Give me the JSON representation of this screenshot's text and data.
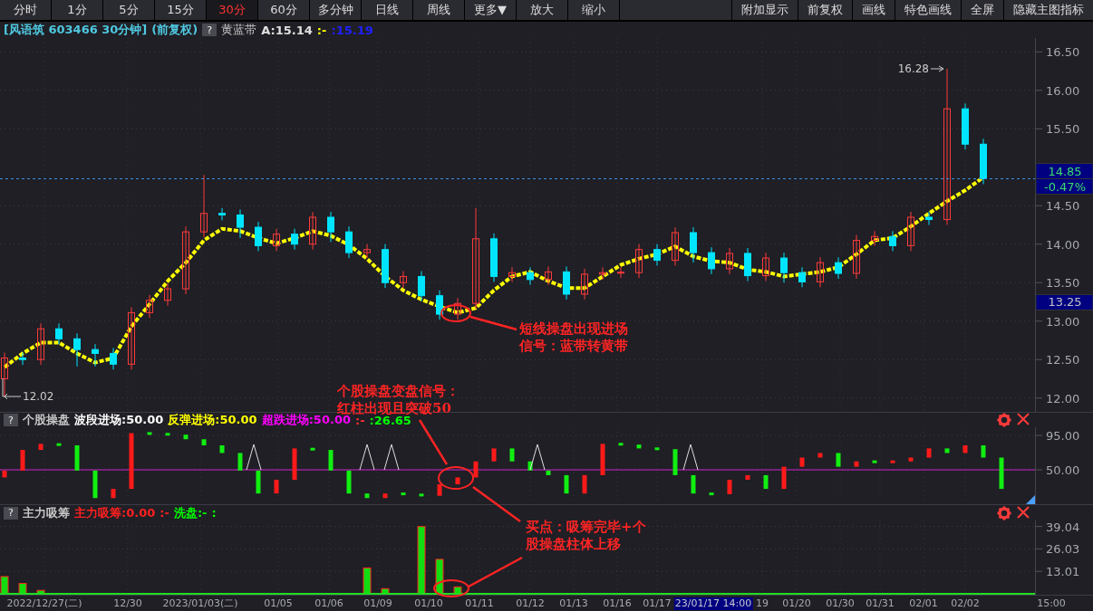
{
  "toolbar": {
    "periods": [
      {
        "label": "分时",
        "selected": false
      },
      {
        "label": "1分",
        "selected": false
      },
      {
        "label": "5分",
        "selected": false
      },
      {
        "label": "15分",
        "selected": false
      },
      {
        "label": "30分",
        "selected": true
      },
      {
        "label": "60分",
        "selected": false
      },
      {
        "label": "多分钟",
        "selected": false
      },
      {
        "label": "日线",
        "selected": false
      },
      {
        "label": "周线",
        "selected": false
      }
    ],
    "tools_left": [
      "更多▼",
      "放大",
      "缩小"
    ],
    "tools_right": [
      "附加显示",
      "前复权",
      "画线",
      "特色画线",
      "全屏",
      "隐藏主图指标"
    ]
  },
  "main_panel": {
    "legend": [
      {
        "kind": "text",
        "text": "[风语筑 603466 30分钟]",
        "color": "#4fc8e0"
      },
      {
        "kind": "text",
        "text": "(前复权)",
        "color": "#4fc8e0"
      },
      {
        "kind": "help",
        "text": "?"
      },
      {
        "kind": "series"
      },
      {
        "kind": "text",
        "text": "A:15.14",
        "color": "#e0e0e0"
      },
      {
        "kind": "text",
        "text": ":-",
        "color": "#ffff00"
      },
      {
        "kind": "text",
        "text": ":15.19",
        "color": "#2020ff"
      }
    ],
    "chart_data": {
      "type": "candlestick",
      "grid": true,
      "ylim": [
        11.82,
        16.68
      ],
      "yticks": [
        {
          "value": 12,
          "label": "12.00"
        },
        {
          "value": 12.5,
          "label": "12.50"
        },
        {
          "value": 13,
          "label": "13.00"
        },
        {
          "value": 13.5,
          "label": "13.50"
        },
        {
          "value": 14,
          "label": "14.00"
        },
        {
          "value": 14.5,
          "label": "14.50"
        },
        {
          "value": 15.5,
          "label": "15.50"
        },
        {
          "value": 16,
          "label": "16.00"
        },
        {
          "value": 16.5,
          "label": "16.50"
        }
      ],
      "ohlc": [
        [
          12.25,
          12.59,
          12.02,
          12.52
        ],
        [
          12.52,
          12.59,
          12.43,
          12.5
        ],
        [
          12.5,
          12.97,
          12.43,
          12.9
        ],
        [
          12.9,
          12.97,
          12.7,
          12.77
        ],
        [
          12.77,
          12.84,
          12.41,
          12.63
        ],
        [
          12.63,
          12.7,
          12.41,
          12.58
        ],
        [
          12.58,
          12.65,
          12.37,
          12.44
        ],
        [
          12.44,
          13.18,
          12.37,
          13.11
        ],
        [
          13.11,
          13.34,
          13.04,
          13.27
        ],
        [
          13.27,
          13.49,
          13.2,
          13.42
        ],
        [
          13.42,
          14.23,
          13.35,
          14.16
        ],
        [
          14.16,
          14.9,
          14.09,
          14.4
        ],
        [
          14.4,
          14.47,
          14.31,
          14.38
        ],
        [
          14.38,
          14.45,
          14.08,
          14.22
        ],
        [
          14.22,
          14.29,
          13.91,
          13.98
        ],
        [
          13.98,
          14.2,
          13.91,
          14.13
        ],
        [
          14.13,
          14.2,
          13.93,
          14.0
        ],
        [
          14.0,
          14.42,
          13.93,
          14.35
        ],
        [
          14.35,
          14.42,
          14.03,
          14.16
        ],
        [
          14.16,
          14.23,
          13.82,
          13.89
        ],
        [
          13.89,
          14.0,
          13.82,
          13.93
        ],
        [
          13.93,
          14.0,
          13.43,
          13.5
        ],
        [
          13.5,
          13.65,
          13.43,
          13.58
        ],
        [
          13.58,
          13.65,
          13.26,
          13.33
        ],
        [
          13.33,
          13.4,
          13.02,
          13.09
        ],
        [
          13.09,
          13.3,
          13.02,
          13.23
        ],
        [
          13.23,
          14.47,
          13.16,
          14.07
        ],
        [
          14.07,
          14.14,
          13.51,
          13.58
        ],
        [
          13.58,
          13.7,
          13.51,
          13.63
        ],
        [
          13.63,
          13.7,
          13.47,
          13.54
        ],
        [
          13.54,
          13.71,
          13.47,
          13.64
        ],
        [
          13.64,
          13.71,
          13.28,
          13.35
        ],
        [
          13.35,
          13.68,
          13.28,
          13.61
        ],
        [
          13.61,
          13.7,
          13.54,
          13.63
        ],
        [
          13.63,
          13.7,
          13.56,
          13.63
        ],
        [
          13.63,
          14.0,
          13.56,
          13.93
        ],
        [
          13.93,
          14.0,
          13.72,
          13.79
        ],
        [
          13.79,
          14.22,
          13.72,
          14.15
        ],
        [
          14.15,
          14.22,
          13.76,
          13.89
        ],
        [
          13.89,
          13.96,
          13.61,
          13.68
        ],
        [
          13.68,
          13.95,
          13.61,
          13.88
        ],
        [
          13.88,
          13.95,
          13.52,
          13.59
        ],
        [
          13.59,
          13.89,
          13.52,
          13.82
        ],
        [
          13.82,
          13.89,
          13.5,
          13.63
        ],
        [
          13.63,
          13.7,
          13.44,
          13.51
        ],
        [
          13.51,
          13.83,
          13.44,
          13.76
        ],
        [
          13.76,
          13.83,
          13.55,
          13.62
        ],
        [
          13.62,
          14.12,
          13.55,
          14.05
        ],
        [
          14.05,
          14.17,
          13.98,
          14.1
        ],
        [
          14.1,
          14.17,
          13.91,
          13.98
        ],
        [
          13.98,
          14.42,
          13.91,
          14.35
        ],
        [
          14.35,
          14.42,
          14.25,
          14.32
        ],
        [
          14.32,
          16.28,
          14.25,
          15.76
        ],
        [
          15.76,
          15.83,
          15.23,
          15.3
        ],
        [
          15.3,
          15.37,
          14.78,
          14.85
        ]
      ],
      "series": [
        {
          "name": "黄蓝带",
          "type": "line",
          "color": "#ffff00",
          "line_style": "dashed",
          "values": [
            12.4,
            12.58,
            12.72,
            12.72,
            12.58,
            12.46,
            12.52,
            12.93,
            13.22,
            13.52,
            13.76,
            14.05,
            14.2,
            14.17,
            14.08,
            14.01,
            14.08,
            14.17,
            14.11,
            13.99,
            13.81,
            13.58,
            13.4,
            13.28,
            13.19,
            13.11,
            13.17,
            13.4,
            13.58,
            13.64,
            13.52,
            13.43,
            13.43,
            13.58,
            13.73,
            13.81,
            13.87,
            13.97,
            13.84,
            13.78,
            13.76,
            13.67,
            13.64,
            13.58,
            13.61,
            13.64,
            13.7,
            13.87,
            14.05,
            14.08,
            14.23,
            14.4,
            14.56,
            14.7,
            14.87
          ]
        }
      ],
      "ref_lines": [
        {
          "axis": "y",
          "value": 14.85
        }
      ],
      "annotations": [
        "16.28",
        "12.02"
      ]
    },
    "price_tags": [
      {
        "kind": "above",
        "text": "14.85"
      },
      {
        "kind": "below",
        "text": "-0.47%"
      },
      {
        "kind": "cursor",
        "text": "13.25"
      }
    ]
  },
  "osc_panel": {
    "legend": [
      {
        "kind": "help",
        "text": "?"
      },
      {
        "kind": "text",
        "text": "个股操盘",
        "color": "#c8c8c8"
      },
      {
        "kind": "text",
        "text": "波段进场:50.00",
        "color": "#ffffff"
      },
      {
        "kind": "text",
        "text": "反弹进场:50.00",
        "color": "#ffff00"
      },
      {
        "kind": "text",
        "text": "超跌进场:50.00",
        "color": "#ff00ff"
      },
      {
        "kind": "text",
        "text": ":-",
        "color": "#ff3030"
      },
      {
        "kind": "text",
        "text": ":26.65",
        "color": "#00ff00"
      }
    ],
    "chart_data": {
      "type": "candlestick",
      "grid": true,
      "ylim": [
        5,
        105.7
      ],
      "yticks": [
        {
          "value": 95,
          "label": "95.00"
        },
        {
          "value": 50,
          "label": "50.00"
        }
      ],
      "ohlc": [
        [
          40,
          49,
          40,
          49
        ],
        [
          49,
          76,
          49,
          76
        ],
        [
          76,
          84,
          76,
          84
        ],
        [
          84,
          84,
          82,
          82
        ],
        [
          82,
          82,
          49,
          49
        ],
        [
          49,
          49,
          13,
          13
        ],
        [
          13,
          25,
          13,
          25
        ],
        [
          25,
          98,
          25,
          98
        ],
        [
          98,
          98,
          97,
          97
        ],
        [
          97,
          97,
          96,
          96
        ],
        [
          96,
          96,
          90,
          90
        ],
        [
          90,
          90,
          82,
          82
        ],
        [
          82,
          82,
          72,
          72
        ],
        [
          72,
          72,
          49,
          49
        ],
        [
          49,
          49,
          19,
          19
        ],
        [
          19,
          37,
          19,
          37
        ],
        [
          37,
          78,
          37,
          78
        ],
        [
          78,
          78,
          76,
          76
        ],
        [
          76,
          76,
          49,
          49
        ],
        [
          49,
          49,
          19,
          19
        ],
        [
          19,
          19,
          13,
          13
        ],
        [
          13,
          19,
          13,
          19
        ],
        [
          19,
          19,
          18,
          18
        ],
        [
          18,
          18,
          16,
          16
        ],
        [
          16,
          31,
          16,
          31
        ],
        [
          31,
          40,
          31,
          40
        ],
        [
          40,
          61,
          40,
          61
        ],
        [
          61,
          78,
          61,
          78
        ],
        [
          78,
          78,
          61,
          61
        ],
        [
          61,
          61,
          49,
          49
        ],
        [
          49,
          49,
          43,
          43
        ],
        [
          43,
          43,
          19,
          19
        ],
        [
          19,
          43,
          19,
          43
        ],
        [
          43,
          84,
          43,
          84
        ],
        [
          84,
          84,
          83,
          83
        ],
        [
          83,
          83,
          78,
          78
        ],
        [
          78,
          78,
          77,
          77
        ],
        [
          77,
          77,
          43,
          43
        ],
        [
          43,
          43,
          19,
          19
        ],
        [
          19,
          19,
          18,
          18
        ],
        [
          18,
          37,
          18,
          37
        ],
        [
          37,
          43,
          37,
          43
        ],
        [
          43,
          43,
          25,
          25
        ],
        [
          25,
          54,
          25,
          54
        ],
        [
          54,
          66,
          54,
          66
        ],
        [
          66,
          72,
          66,
          72
        ],
        [
          72,
          72,
          54,
          54
        ],
        [
          54,
          61,
          54,
          61
        ],
        [
          61,
          61,
          60,
          60
        ],
        [
          60,
          61,
          60,
          61
        ],
        [
          61,
          66,
          61,
          66
        ],
        [
          66,
          78,
          66,
          78
        ],
        [
          78,
          78,
          72,
          72
        ],
        [
          72,
          82,
          72,
          82
        ],
        [
          82,
          82,
          66,
          66
        ],
        [
          66,
          66,
          25,
          25
        ]
      ],
      "ref_lines": [
        {
          "axis": "y",
          "value": 50
        }
      ]
    }
  },
  "vol_panel": {
    "legend": [
      {
        "kind": "help",
        "text": "?"
      },
      {
        "kind": "text",
        "text": "主力吸筹",
        "color": "#c8c8c8"
      },
      {
        "kind": "text",
        "text": "主力吸筹:0.00",
        "color": "#ff2020"
      },
      {
        "kind": "text",
        "text": ":-",
        "color": "#ff2020"
      },
      {
        "kind": "text",
        "text": "洗盘:-",
        "color": "#00ff00"
      },
      {
        "kind": "text",
        "text": ":",
        "color": "#00ff00"
      }
    ],
    "chart_data": {
      "type": "bar",
      "grid": true,
      "ylim": [
        0,
        42.5
      ],
      "yticks": [
        {
          "value": 39.04,
          "label": "39.04"
        },
        {
          "value": 26.03,
          "label": "26.03"
        },
        {
          "value": 13.01,
          "label": "13.01"
        }
      ],
      "values": [
        10,
        6,
        2,
        0,
        0,
        0,
        0,
        0,
        0,
        0,
        0,
        0,
        0,
        0,
        0,
        0,
        0,
        0,
        0,
        0,
        15,
        3,
        0,
        39,
        20,
        4,
        0,
        0,
        0,
        0,
        0,
        0,
        0,
        0,
        0,
        0,
        0,
        0,
        0,
        0,
        0,
        0,
        0,
        0,
        0,
        0,
        0,
        0,
        0,
        0,
        0,
        0,
        0,
        0,
        0
      ]
    }
  },
  "time_axis": {
    "labels": [
      "2022/12/27(二)",
      "12/30",
      "2023/01/03(二)",
      "01/05",
      "01/06",
      "01/09",
      "01/10",
      "01/11",
      "01/12",
      "01/13",
      "01/16",
      "01/17",
      "19",
      "01/20",
      "01/30",
      "01/31",
      "02/01",
      "02/02"
    ],
    "cursor_label": "23/01/17 14:00",
    "end_label": "15:00"
  },
  "annotations": [
    {
      "lines": [
        "短线操盘出现进场",
        "信号：蓝带转黄带"
      ]
    },
    {
      "lines": [
        "个股操盘变盘信号：",
        "红柱出现且突破50"
      ]
    },
    {
      "lines": [
        "买点：吸筹完毕+个",
        "股操盘柱体上移"
      ]
    }
  ]
}
